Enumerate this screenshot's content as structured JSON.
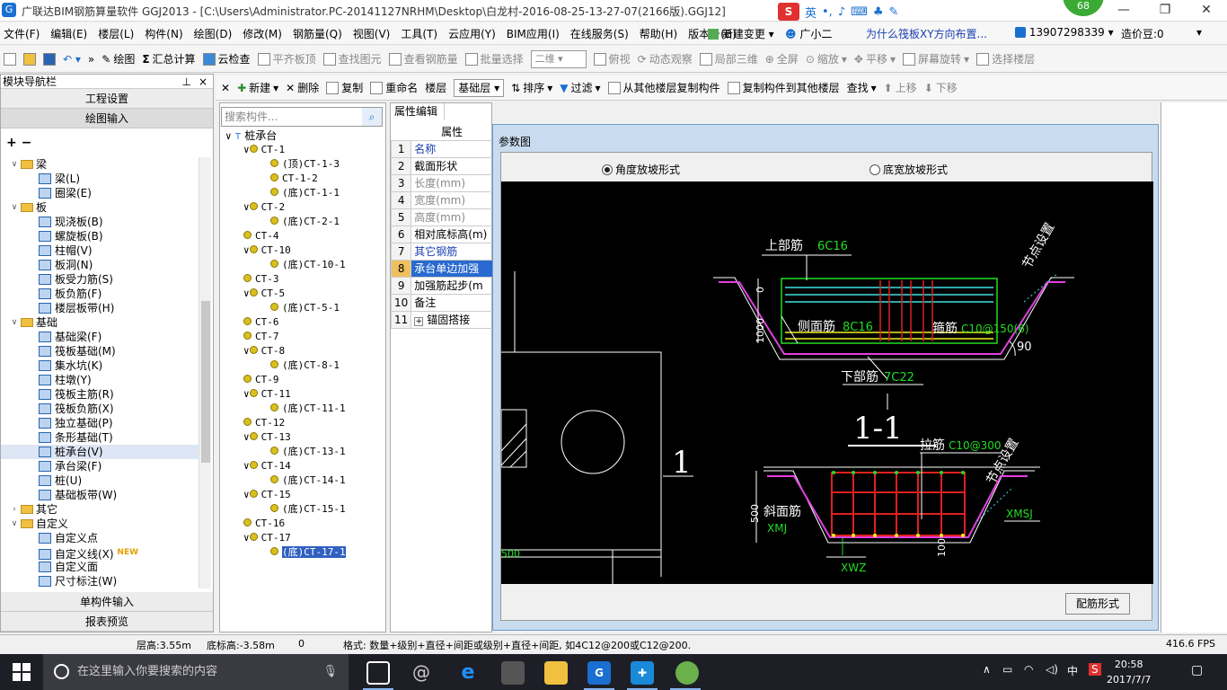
{
  "window": {
    "title": "广联达BIM钢筋算量软件 GGJ2013 - [C:\\Users\\Administrator.PC-20141127NRHM\\Desktop\\白龙村-2016-08-25-13-27-07(2166版).GGJ12]",
    "ime_label": "英",
    "badge_count": "68"
  },
  "menu": {
    "items": [
      "文件(F)",
      "编辑(E)",
      "楼层(L)",
      "构件(N)",
      "绘图(D)",
      "修改(M)",
      "钢筋量(Q)",
      "视图(V)",
      "工具(T)",
      "云应用(Y)",
      "BIM应用(I)",
      "在线服务(S)",
      "帮助(H)",
      "版本号(B)"
    ],
    "new_change": "新建变更",
    "assistant": "广小二",
    "question": "为什么筏板XY方向布置...",
    "phone": "13907298339",
    "price_bean": "造价豆:0"
  },
  "toolbar1": {
    "draw": "绘图",
    "summary": "汇总计算",
    "cloud_check": "云检查",
    "align_top": "平齐板顶",
    "find_elem": "查找图元",
    "view_rebar": "查看钢筋量",
    "batch_select": "批量选择",
    "view_mode": "二维",
    "top_view": "俯视",
    "dynamic_view": "动态观察",
    "local_3d": "局部三维",
    "fullscreen": "全屏",
    "zoom": "缩放",
    "pan": "平移",
    "rotate": "屏幕旋转",
    "select_floor": "选择楼层"
  },
  "left_panel": {
    "title": "模块导航栏",
    "project_settings": "工程设置",
    "drawing_input": "绘图输入",
    "single_input": "单构件输入",
    "report_preview": "报表预览",
    "tree": [
      {
        "level": 0,
        "type": "folder",
        "label": "梁",
        "expanded": true
      },
      {
        "level": 1,
        "type": "item",
        "label": "梁(L)"
      },
      {
        "level": 1,
        "type": "item",
        "label": "圈梁(E)"
      },
      {
        "level": 0,
        "type": "folder",
        "label": "板",
        "expanded": true
      },
      {
        "level": 1,
        "type": "item",
        "label": "现浇板(B)"
      },
      {
        "level": 1,
        "type": "item",
        "label": "螺旋板(B)"
      },
      {
        "level": 1,
        "type": "item",
        "label": "柱帽(V)"
      },
      {
        "level": 1,
        "type": "item",
        "label": "板洞(N)"
      },
      {
        "level": 1,
        "type": "item",
        "label": "板受力筋(S)"
      },
      {
        "level": 1,
        "type": "item",
        "label": "板负筋(F)"
      },
      {
        "level": 1,
        "type": "item",
        "label": "楼层板带(H)"
      },
      {
        "level": 0,
        "type": "folder",
        "label": "基础",
        "expanded": true
      },
      {
        "level": 1,
        "type": "item",
        "label": "基础梁(F)"
      },
      {
        "level": 1,
        "type": "item",
        "label": "筏板基础(M)"
      },
      {
        "level": 1,
        "type": "item",
        "label": "集水坑(K)"
      },
      {
        "level": 1,
        "type": "item",
        "label": "柱墩(Y)"
      },
      {
        "level": 1,
        "type": "item",
        "label": "筏板主筋(R)"
      },
      {
        "level": 1,
        "type": "item",
        "label": "筏板负筋(X)"
      },
      {
        "level": 1,
        "type": "item",
        "label": "独立基础(P)"
      },
      {
        "level": 1,
        "type": "item",
        "label": "条形基础(T)"
      },
      {
        "level": 1,
        "type": "item",
        "label": "桩承台(V)",
        "selected": true
      },
      {
        "level": 1,
        "type": "item",
        "label": "承台梁(F)"
      },
      {
        "level": 1,
        "type": "item",
        "label": "桩(U)"
      },
      {
        "level": 1,
        "type": "item",
        "label": "基础板带(W)"
      },
      {
        "level": 0,
        "type": "folder",
        "label": "其它",
        "expanded": false
      },
      {
        "level": 0,
        "type": "folder",
        "label": "自定义",
        "expanded": true
      },
      {
        "level": 1,
        "type": "item",
        "label": "自定义点"
      },
      {
        "level": 1,
        "type": "item",
        "label": "自定义线(X)",
        "new": "NEW"
      },
      {
        "level": 1,
        "type": "item",
        "label": "自定义面"
      },
      {
        "level": 1,
        "type": "item",
        "label": "尺寸标注(W)"
      }
    ]
  },
  "mid_toolbar": {
    "new": "新建",
    "delete": "删除",
    "copy": "复制",
    "rename": "重命名",
    "floor_label": "楼层",
    "floor_value": "基础层",
    "sort": "排序",
    "filter": "过滤",
    "copy_from": "从其他楼层复制构件",
    "copy_to": "复制构件到其他楼层",
    "find": "查找",
    "move_up": "上移",
    "move_down": "下移"
  },
  "component_tree": {
    "search_placeholder": "搜索构件...",
    "root": "桩承台",
    "rows": [
      {
        "level": 1,
        "label": "CT-1",
        "exp": true
      },
      {
        "level": 2,
        "label": "(顶)CT-1-3"
      },
      {
        "level": 2,
        "label": "CT-1-2"
      },
      {
        "level": 2,
        "label": "(底)CT-1-1"
      },
      {
        "level": 1,
        "label": "CT-2",
        "exp": true
      },
      {
        "level": 2,
        "label": "(底)CT-2-1"
      },
      {
        "level": 1,
        "label": "CT-4"
      },
      {
        "level": 1,
        "label": "CT-10",
        "exp": true
      },
      {
        "level": 2,
        "label": "(底)CT-10-1"
      },
      {
        "level": 1,
        "label": "CT-3"
      },
      {
        "level": 1,
        "label": "CT-5",
        "exp": true
      },
      {
        "level": 2,
        "label": "(底)CT-5-1"
      },
      {
        "level": 1,
        "label": "CT-6"
      },
      {
        "level": 1,
        "label": "CT-7"
      },
      {
        "level": 1,
        "label": "CT-8",
        "exp": true
      },
      {
        "level": 2,
        "label": "(底)CT-8-1"
      },
      {
        "level": 1,
        "label": "CT-9"
      },
      {
        "level": 1,
        "label": "CT-11",
        "exp": true
      },
      {
        "level": 2,
        "label": "(底)CT-11-1"
      },
      {
        "level": 1,
        "label": "CT-12"
      },
      {
        "level": 1,
        "label": "CT-13",
        "exp": true
      },
      {
        "level": 2,
        "label": "(底)CT-13-1"
      },
      {
        "level": 1,
        "label": "CT-14",
        "exp": true
      },
      {
        "level": 2,
        "label": "(底)CT-14-1"
      },
      {
        "level": 1,
        "label": "CT-15",
        "exp": true
      },
      {
        "level": 2,
        "label": "(底)CT-15-1"
      },
      {
        "level": 1,
        "label": "CT-16"
      },
      {
        "level": 1,
        "label": "CT-17",
        "exp": true
      },
      {
        "level": 2,
        "label": "(底)CT-17-1",
        "selected": true
      }
    ]
  },
  "properties": {
    "tab": "属性编辑",
    "header": "属性",
    "rows": [
      {
        "n": "1",
        "label": "名称",
        "style": "blue"
      },
      {
        "n": "2",
        "label": "截面形状",
        "style": ""
      },
      {
        "n": "3",
        "label": "长度(mm)",
        "style": "gray"
      },
      {
        "n": "4",
        "label": "宽度(mm)",
        "style": "gray"
      },
      {
        "n": "5",
        "label": "高度(mm)",
        "style": "gray"
      },
      {
        "n": "6",
        "label": "相对底标高(m)",
        "style": ""
      },
      {
        "n": "7",
        "label": "其它钢筋",
        "style": "blue"
      },
      {
        "n": "8",
        "label": "承台单边加强",
        "style": "hl"
      },
      {
        "n": "9",
        "label": "加强筋起步(m",
        "style": ""
      },
      {
        "n": "10",
        "label": "备注",
        "style": ""
      },
      {
        "n": "11",
        "label": "锚固搭接",
        "style": "plus"
      }
    ]
  },
  "dialog": {
    "title": "参数图",
    "radio1": "角度放坡形式",
    "radio2": "底宽放坡形式",
    "button": "配筋形式",
    "drawing": {
      "top_bar": "上部筋",
      "top_bar_val": "6C16",
      "node_set": "节点设置",
      "side_bar": "侧面筋",
      "side_bar_val": "8C16",
      "stirrup": "箍筋",
      "stirrup_val": "C10@150(6)",
      "angle": "90",
      "bottom_bar": "下部筋",
      "bottom_bar_val": "7C22",
      "zero": "0",
      "dim_1000": "1000",
      "section": "1-1",
      "mark_1": "1",
      "tie_bar": "拉筋",
      "tie_bar_val": "C10@300",
      "node_set2": "节点设置",
      "slope_bar": "斜面筋",
      "xmj": "XMJ",
      "xmsj": "XMSJ",
      "dim_500": "500",
      "dim_100": "100",
      "xwz": "XWZ",
      "dim_left": "500"
    }
  },
  "status": {
    "floor_height": "层高:3.55m",
    "bottom_elev": "底标高:-3.58m",
    "zero": "0",
    "format": "格式: 数量+级别+直径+间距或级别+直径+间距, 如4C12@200或C12@200.",
    "fps": "416.6 FPS"
  },
  "taskbar": {
    "search_placeholder": "在这里输入你要搜索的内容",
    "ime": "中",
    "time": "20:58",
    "date": "2017/7/7"
  },
  "colors": {
    "accent": "#1a6fd0",
    "selection": "#3060c0",
    "canvas_bg": "#000000",
    "green_text": "#22dd22",
    "magenta": "#e040e0",
    "cyan": "#40e0e0",
    "red": "#e02020",
    "yellow": "#f0f020"
  }
}
